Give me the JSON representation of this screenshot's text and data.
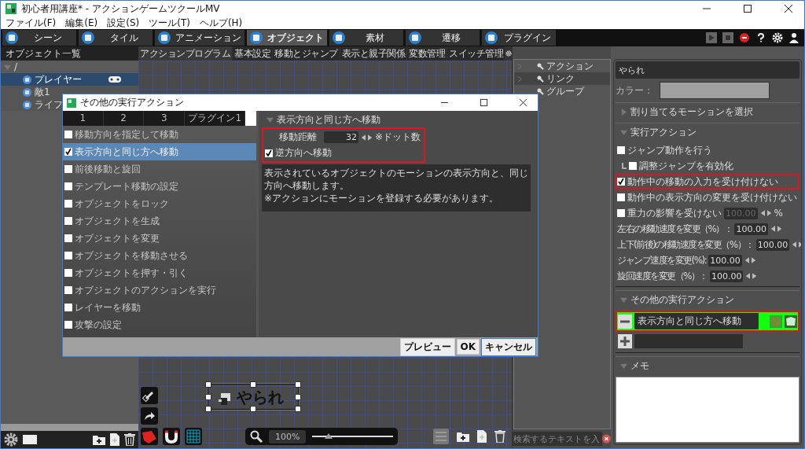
{
  "window": {
    "title": "初心者用講座* - アクションゲームツクールMV"
  },
  "menu": [
    "ファイル(F)",
    "編集(E)",
    "設定(S)",
    "ツール(T)",
    "ヘルプ(H)"
  ],
  "modes": [
    {
      "label": "シーン",
      "selected": false
    },
    {
      "label": "タイル",
      "selected": false
    },
    {
      "label": "アニメーション",
      "selected": false
    },
    {
      "label": "オブジェクト",
      "selected": true
    },
    {
      "label": "素材",
      "selected": false
    },
    {
      "label": "遷移",
      "selected": false
    },
    {
      "label": "プラグイン",
      "selected": false
    }
  ],
  "object_list": {
    "title": "オブジェクト一覧",
    "tree": [
      {
        "label": "/",
        "expanded": true,
        "selected": false,
        "children": [
          {
            "label": "プレイヤー",
            "selected": true,
            "player": true
          },
          {
            "label": "敵1",
            "selected": false,
            "player": false
          },
          {
            "label": "ライフ",
            "selected": false,
            "player": false
          }
        ]
      }
    ]
  },
  "editor_tabs": [
    {
      "label": "アクションプログラム",
      "selected": true
    },
    {
      "label": "基本設定",
      "selected": false
    },
    {
      "label": "移動とジャンプ",
      "selected": false
    },
    {
      "label": "表示と親子関係",
      "selected": false
    },
    {
      "label": "変数管理",
      "selected": false
    },
    {
      "label": "スイッチ管理",
      "selected": false
    }
  ],
  "canvas": {
    "node": {
      "label": "やられ",
      "selected": true
    },
    "zoom": "100%",
    "zoom_slider": {
      "level": 0.2
    }
  },
  "palette": {
    "items": [
      {
        "label": "アクション",
        "expandable": true,
        "selected": false
      },
      {
        "label": "リンク",
        "expandable": true,
        "selected": true
      },
      {
        "label": "グループ",
        "expandable": false,
        "selected": false
      }
    ],
    "search": {
      "placeholder": "検索するテキストを入"
    }
  },
  "properties": {
    "name": "やられ",
    "color_label": "カラー：",
    "motion_section": {
      "title": "割り当てるモーションを選択",
      "expanded": false
    },
    "action_section": {
      "title": "実行アクション",
      "expanded": true,
      "options": [
        {
          "kind": "check",
          "label": "ジャンプ動作を行う",
          "checked": false,
          "highlighted": false
        },
        {
          "kind": "subcheck",
          "label": "調整ジャンプを有効化",
          "checked": false,
          "highlighted": false
        },
        {
          "kind": "check",
          "label": "動作中の移動の入力を受け付けない",
          "checked": true,
          "highlighted": true
        },
        {
          "kind": "check",
          "label": "動作中の表示方向の変更を受け付けない",
          "checked": false,
          "highlighted": false
        },
        {
          "kind": "check_value",
          "label": "重力の影響を受けない",
          "checked": false,
          "highlighted": false,
          "value": "100.00",
          "unit": "%",
          "disabled": true
        }
      ],
      "speeds": [
        {
          "label": "左右の移動速度を変更（%）：",
          "value": "100.00"
        },
        {
          "label": "上下(前後)の移動速度を変更（%）：",
          "value": "100.00"
        },
        {
          "label": "ジャンプ速度を変更(%):",
          "value": "100.00"
        },
        {
          "label": "旋回速度を変更（%）：",
          "value": "100.00"
        }
      ]
    },
    "other_section": {
      "title": "その他の実行アクション",
      "expanded": true,
      "actions": [
        {
          "label": "表示方向と同じ方へ移動",
          "highlighted": true
        }
      ]
    },
    "memo_section": {
      "title": "メモ",
      "expanded": true
    }
  },
  "dialog": {
    "title": "その他の実行アクション",
    "tabs": [
      {
        "label": "1",
        "selected": false
      },
      {
        "label": "2",
        "selected": false
      },
      {
        "label": "3",
        "selected": false
      },
      {
        "label": "プラグイン1",
        "selected": false
      }
    ],
    "actions": [
      {
        "label": "移動方向を指定して移動",
        "checked": false,
        "selected": false
      },
      {
        "label": "表示方向と同じ方へ移動",
        "checked": true,
        "selected": true
      },
      {
        "label": "前後移動と旋回",
        "checked": false,
        "selected": false
      },
      {
        "label": "テンプレート移動の設定",
        "checked": false,
        "selected": false
      },
      {
        "label": "オブジェクトをロック",
        "checked": false,
        "selected": false
      },
      {
        "label": "オブジェクトを生成",
        "checked": false,
        "selected": false
      },
      {
        "label": "オブジェクトを変更",
        "checked": false,
        "selected": false
      },
      {
        "label": "オブジェクトを移動させる",
        "checked": false,
        "selected": false
      },
      {
        "label": "オブジェクトを押す・引く",
        "checked": false,
        "selected": false
      },
      {
        "label": "オブジェクトのアクションを実行",
        "checked": false,
        "selected": false
      },
      {
        "label": "レイヤーを移動",
        "checked": false,
        "selected": false
      },
      {
        "label": "攻撃の設定",
        "checked": false,
        "selected": false
      }
    ],
    "detail": {
      "title": "表示方向と同じ方へ移動",
      "highlighted": true,
      "distance_label": "移動距離",
      "distance": "32",
      "distance_unit": "※ドット数",
      "reverse": {
        "label": "逆方向へ移動",
        "checked": true
      },
      "description": "表示されているオブジェクトのモーションの表示方向と、同じ方向へ移動します。\n※アクションにモーションを登録する必要があります。"
    },
    "buttons": [
      {
        "label": "プレビュー",
        "focused": false
      },
      {
        "label": "OK",
        "focused": false
      },
      {
        "label": "キャンセル",
        "focused": true
      }
    ]
  }
}
